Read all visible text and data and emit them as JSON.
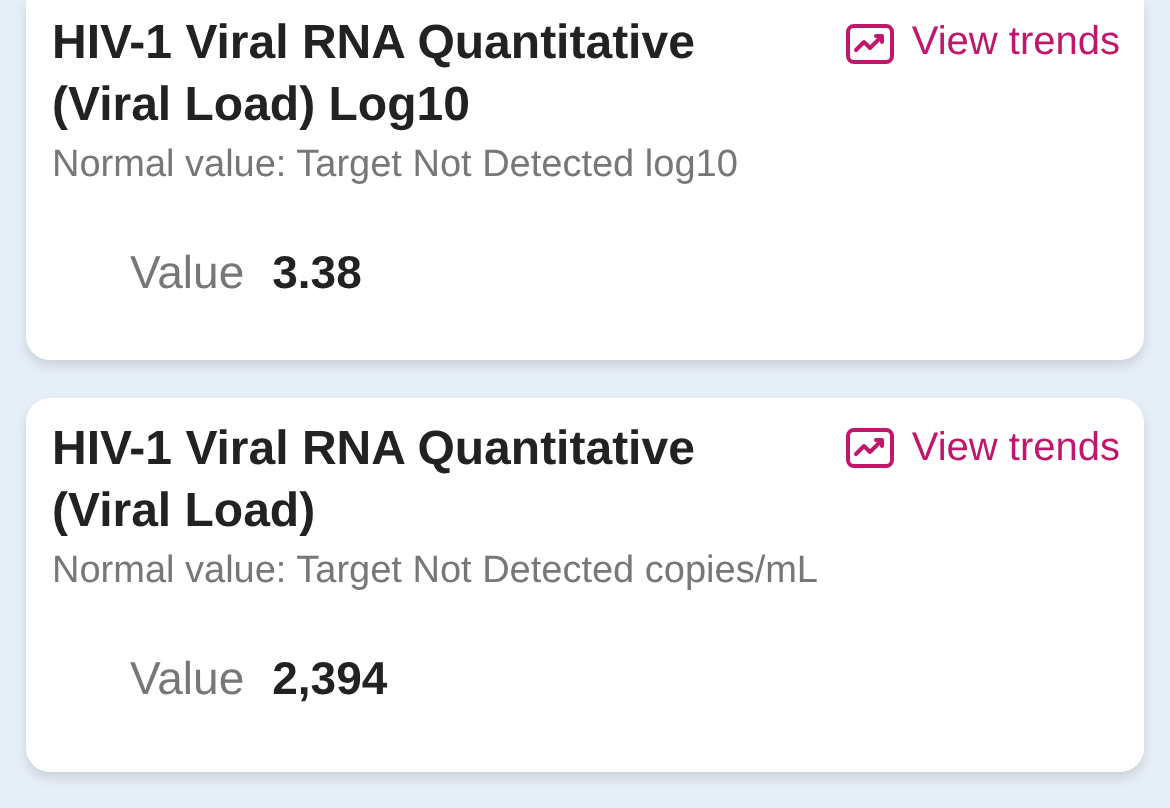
{
  "results": [
    {
      "title": "HIV-1 Viral RNA Quantitative (Viral Load) Log10",
      "trends_link": "View trends",
      "normal_value": "Normal value: Target Not Detected log10",
      "value_label": "Value",
      "value": "3.38"
    },
    {
      "title": "HIV-1 Viral RNA Quantitative (Viral Load)",
      "trends_link": "View trends",
      "normal_value": "Normal value: Target Not Detected copies/mL",
      "value_label": "Value",
      "value": "2,394"
    }
  ]
}
